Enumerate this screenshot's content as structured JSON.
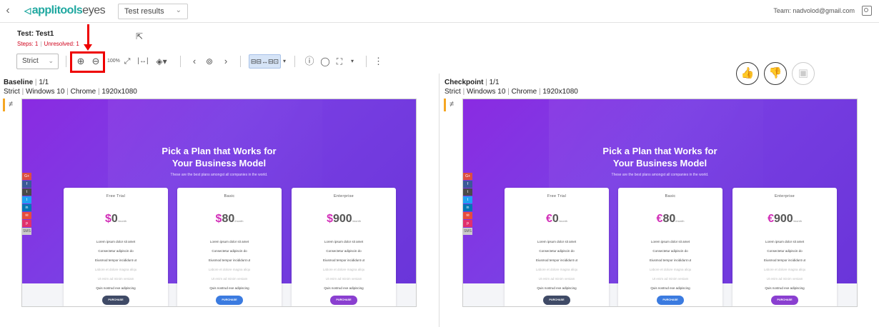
{
  "topbar": {
    "logo_applitools": "applitools",
    "logo_eyes": "eyes",
    "view_select": "Test results",
    "team": "Team: nadvolod@gmail.com"
  },
  "test": {
    "title": "Test: Test1",
    "steps": "Steps: 1",
    "unresolved": "Unresolved: 1"
  },
  "toolbar": {
    "match_level": "Strict",
    "zoom_100": "100%",
    "compare_label": "⊟⊟↔⊟⊡"
  },
  "baseline": {
    "label": "Baseline",
    "count": "1/1",
    "level": "Strict",
    "os": "Windows 10",
    "browser": "Chrome",
    "resolution": "1920x1080"
  },
  "checkpoint": {
    "label": "Checkpoint",
    "count": "1/1",
    "level": "Strict",
    "os": "Windows 10",
    "browser": "Chrome",
    "resolution": "1920x1080"
  },
  "page": {
    "title_line1": "Pick a Plan that Works for",
    "title_line2": "Your Business Model",
    "subtitle": "These are the best plans amongst all companies in the world.",
    "features": [
      "Lorem ipsum dolor sit amet",
      "Consectetur adipiscin do",
      "Eiusmod tempor incididunt ut",
      "Labore et dolore magna aliqu",
      "Ut enim ad minim veniam",
      "Quis nostrud exe adipiscing"
    ],
    "purchase": "PURCHASE",
    "per": "/month",
    "baseline_plans": [
      {
        "name": "Free Trial",
        "currency": "$",
        "amount": "0",
        "button_color": "#3f4a66"
      },
      {
        "name": "Basic",
        "currency": "$",
        "amount": "80",
        "button_color": "#3b7be0"
      },
      {
        "name": "Enterprise",
        "currency": "$",
        "amount": "900",
        "button_color": "#8a3fd0"
      }
    ],
    "checkpoint_plans": [
      {
        "name": "Free Trial",
        "currency": "€",
        "amount": "0",
        "button_color": "#3f4a66"
      },
      {
        "name": "Basic",
        "currency": "€",
        "amount": "80",
        "button_color": "#3b7be0"
      },
      {
        "name": "Enterprise",
        "currency": "€",
        "amount": "900",
        "button_color": "#8a3fd0"
      }
    ],
    "social": [
      "G+",
      "f",
      "t",
      "t",
      "in",
      "✉",
      "p",
      "SMS"
    ]
  }
}
